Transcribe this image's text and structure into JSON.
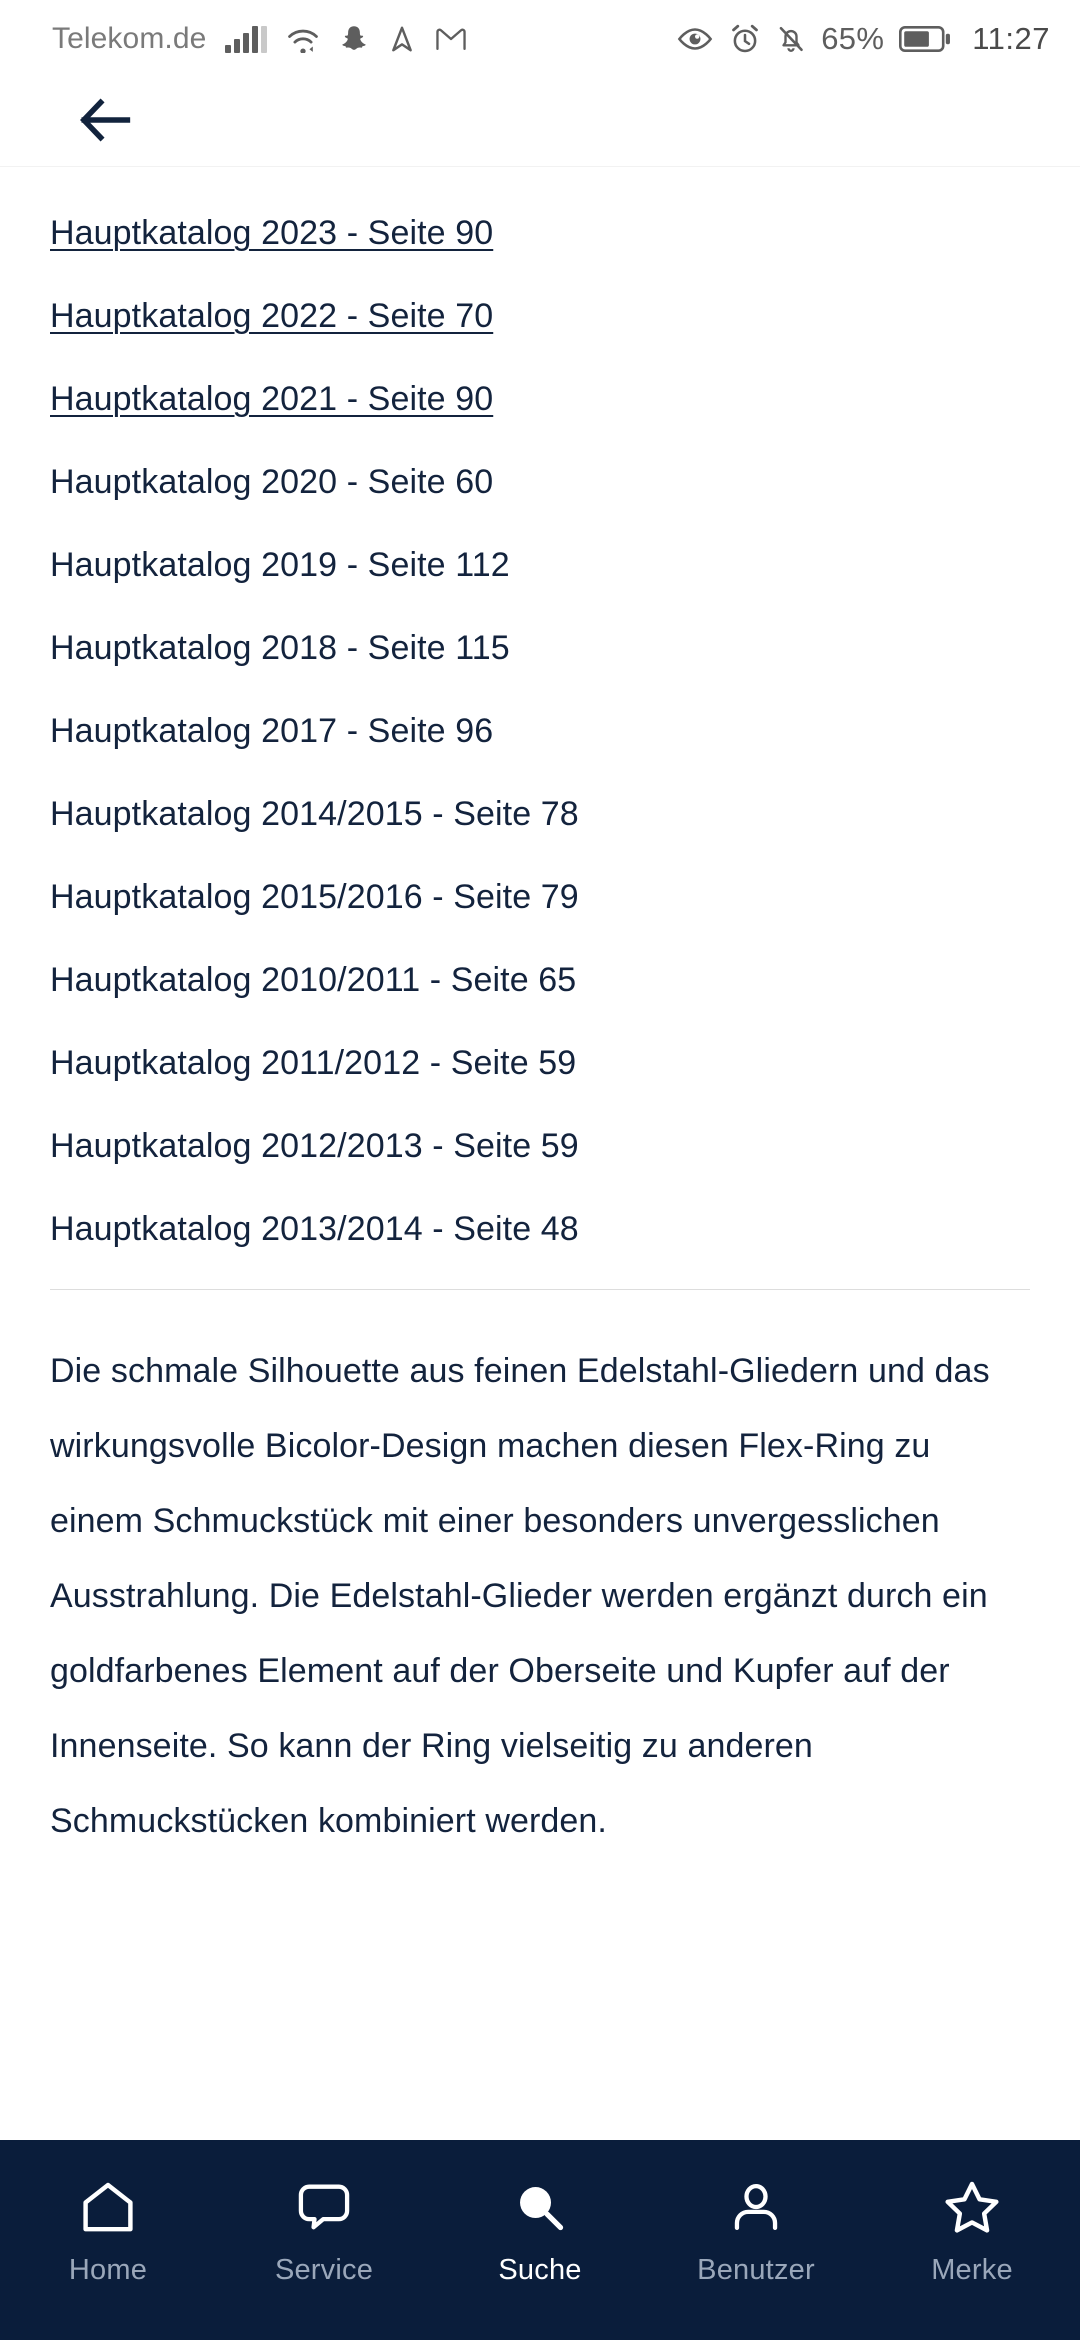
{
  "statusbar": {
    "carrier": "Telekom.de",
    "battery_percent": "65%",
    "time": "11:27",
    "icons": [
      "signal-bars-icon",
      "wifi-icon",
      "snapchat-icon",
      "navigation-arrow-icon",
      "gmail-icon",
      "eye-icon",
      "alarm-clock-icon",
      "bell-muted-icon",
      "battery-icon"
    ]
  },
  "header": {
    "back_icon": "arrow-left-icon"
  },
  "catalog": {
    "items": [
      {
        "label": "Hauptkatalog 2023 - Seite 90",
        "link": true
      },
      {
        "label": "Hauptkatalog 2022 - Seite 70",
        "link": true
      },
      {
        "label": "Hauptkatalog 2021 - Seite 90",
        "link": true
      },
      {
        "label": "Hauptkatalog 2020 - Seite 60",
        "link": false
      },
      {
        "label": "Hauptkatalog 2019 - Seite 112",
        "link": false
      },
      {
        "label": "Hauptkatalog 2018 - Seite 115",
        "link": false
      },
      {
        "label": "Hauptkatalog 2017 - Seite 96",
        "link": false
      },
      {
        "label": "Hauptkatalog 2014/2015 - Seite 78",
        "link": false
      },
      {
        "label": "Hauptkatalog 2015/2016 - Seite 79",
        "link": false
      },
      {
        "label": "Hauptkatalog 2010/2011 - Seite 65",
        "link": false
      },
      {
        "label": "Hauptkatalog 2011/2012 - Seite 59",
        "link": false
      },
      {
        "label": "Hauptkatalog 2012/2013 - Seite 59",
        "link": false
      },
      {
        "label": "Hauptkatalog 2013/2014 - Seite 48",
        "link": false
      }
    ]
  },
  "description": {
    "text": "Die schmale Silhouette aus feinen Edelstahl-Gliedern und das wirkungsvolle Bicolor-Design machen diesen Flex-Ring zu einem Schmuckstück mit einer besonders unvergesslichen Ausstrahlung. Die Edelstahl-Glieder werden ergänzt durch ein goldfarbenes Element auf der Oberseite und Kupfer auf der Innenseite. So kann der Ring vielseitig zu anderen Schmuckstücken kombiniert werden."
  },
  "bottomnav": {
    "items": [
      {
        "label": "Home",
        "icon": "home-icon",
        "active": false
      },
      {
        "label": "Service",
        "icon": "chat-bubble-icon",
        "active": false
      },
      {
        "label": "Suche",
        "icon": "search-icon",
        "active": true
      },
      {
        "label": "Benutzer",
        "icon": "user-icon",
        "active": false
      },
      {
        "label": "Merke",
        "icon": "star-icon",
        "active": false
      }
    ]
  },
  "colors": {
    "brand_navy": "#0a1d3b",
    "text": "#13233d",
    "nav_inactive": "#9aa7ba",
    "divider": "#dddddd"
  }
}
